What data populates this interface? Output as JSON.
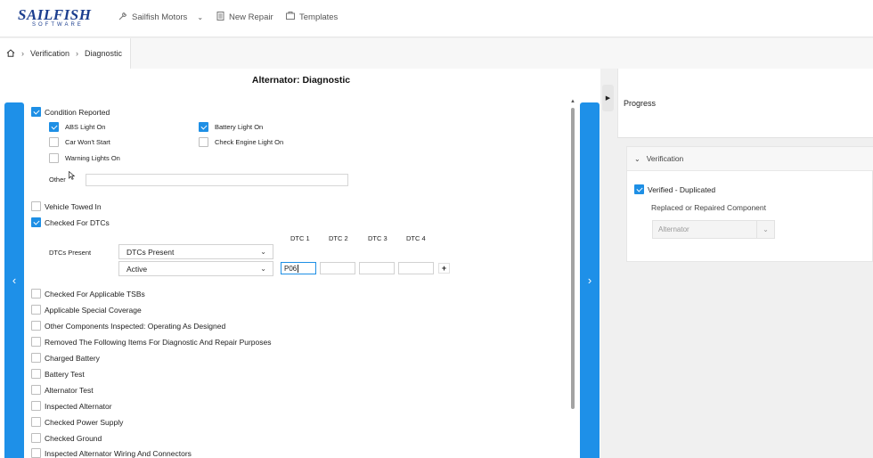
{
  "nav": {
    "logo_main": "SAILFISH",
    "logo_sub": "SOFTWARE",
    "shop": "Sailfish Motors",
    "new_repair": "New Repair",
    "templates": "Templates"
  },
  "breadcrumb": {
    "step1": "Verification",
    "step2": "Diagnostic"
  },
  "page_title": "Alternator: Diagnostic",
  "condition": {
    "label": "Condition Reported",
    "checked": true,
    "options": [
      {
        "label": "ABS Light On",
        "checked": true
      },
      {
        "label": "Battery Light On",
        "checked": true
      },
      {
        "label": "Car Won't Start",
        "checked": false
      },
      {
        "label": "Check Engine Light On",
        "checked": false
      },
      {
        "label": "Warning Lights On",
        "checked": false
      }
    ],
    "other_label": "Other",
    "other_value": ""
  },
  "vehicle_towed": {
    "label": "Vehicle Towed In",
    "checked": false
  },
  "checked_dtcs": {
    "label": "Checked For DTCs",
    "checked": true
  },
  "dtc": {
    "present_label": "DTCs Present",
    "present_select": "DTCs Present",
    "status_select": "Active",
    "headers": [
      "DTC 1",
      "DTC 2",
      "DTC 3",
      "DTC 4"
    ],
    "values": [
      "P06",
      "",
      "",
      ""
    ],
    "add_label": "+"
  },
  "checklist": [
    "Checked For Applicable TSBs",
    "Applicable Special Coverage",
    "Other Components Inspected: Operating As Designed",
    "Removed The Following Items For Diagnostic And Repair Purposes",
    "Charged Battery",
    "Battery Test",
    "Alternator Test",
    "Inspected Alternator",
    "Checked Power Supply",
    "Checked Ground",
    "Inspected Alternator Wiring And Connectors"
  ],
  "right": {
    "progress_title": "Progress",
    "section_title": "Verification",
    "verified_label": "Verified - Duplicated",
    "verified_checked": true,
    "replaced_label": "Replaced or Repaired Component",
    "component_select": "Alternator"
  },
  "colors": {
    "accent": "#1e90e8",
    "logo": "#1d3f8f"
  },
  "icons": {
    "wrench": "wrench-icon",
    "document": "document-icon",
    "template": "template-icon",
    "home": "home-icon"
  }
}
